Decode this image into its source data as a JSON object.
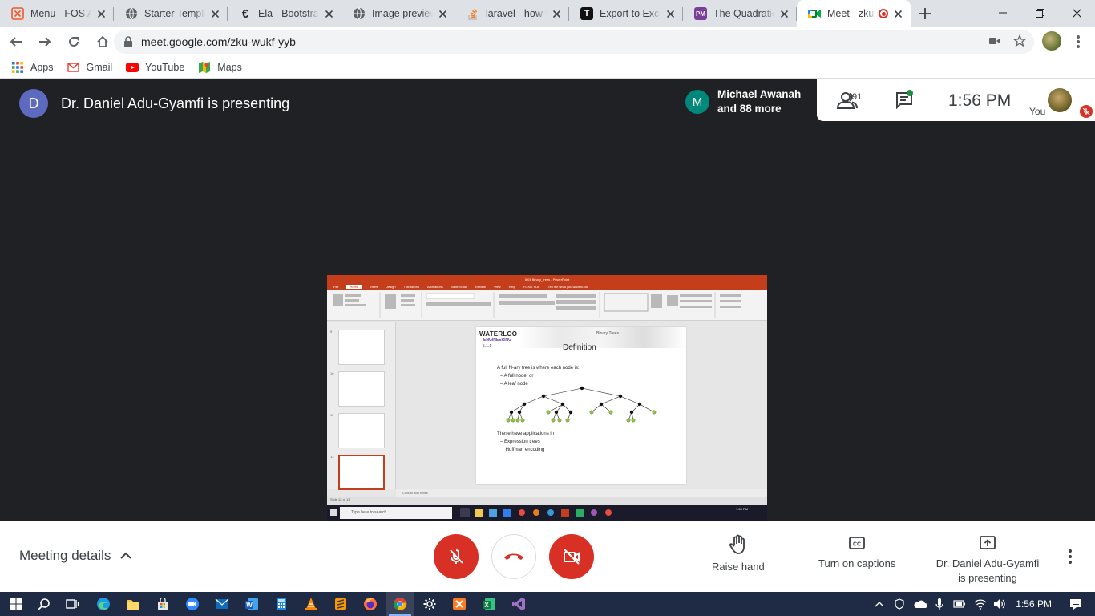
{
  "browser": {
    "tabs": [
      {
        "title": "Menu - FOS Ad",
        "icon": "xampp-icon",
        "color": "#f1592a",
        "glyph": "⊠"
      },
      {
        "title": "Starter Templa",
        "icon": "globe-icon",
        "color": "#5f6368",
        "glyph": ""
      },
      {
        "title": "Ela - Bootstrap",
        "icon": "ela-icon",
        "color": "#202124",
        "glyph": "€"
      },
      {
        "title": "Image preview",
        "icon": "globe-icon",
        "color": "#5f6368",
        "glyph": ""
      },
      {
        "title": "laravel - how to",
        "icon": "stackoverflow-icon",
        "color": "#f48024",
        "glyph": ""
      },
      {
        "title": "Export to Excel",
        "icon": "t-icon",
        "color": "#111111",
        "glyph": "T"
      },
      {
        "title": "The Quadratic",
        "icon": "pm-icon",
        "color": "#7b3f99",
        "glyph": "PM"
      },
      {
        "title": "Meet - zku",
        "icon": "meet-icon",
        "color": "#00832d",
        "glyph": ""
      }
    ],
    "url": "meet.google.com/zku-wukf-yyb",
    "bookmarks": [
      {
        "label": "Apps",
        "icon": "apps-grid-icon"
      },
      {
        "label": "Gmail",
        "icon": "gmail-icon"
      },
      {
        "label": "YouTube",
        "icon": "youtube-icon"
      },
      {
        "label": "Maps",
        "icon": "maps-icon"
      }
    ]
  },
  "meet": {
    "presenter_initial": "D",
    "presenter_text": "Dr. Daniel Adu-Gyamfi is presenting",
    "participant_initial": "M",
    "participant_line1": "Michael Awanah",
    "participant_line2": "and 88 more",
    "people_count": "91",
    "time": "1:56  PM",
    "you_label": "You",
    "colors": {
      "accent_red": "#d93025",
      "presenter_avatar": "#5c6bc0",
      "participant_avatar": "#00897b"
    }
  },
  "shared_screen": {
    "window_title": "5.01 Binary_trees - PowerPoint",
    "ribbon_tabs": [
      "File",
      "Home",
      "Insert",
      "Design",
      "Transitions",
      "Animations",
      "Slide Show",
      "Review",
      "View",
      "Help",
      "FOXIT PDF",
      "Tell me what you want to do"
    ],
    "thumb_numbers": [
      "9",
      "10",
      "11",
      "12"
    ],
    "slide": {
      "logo": "WATERLOO",
      "logo_sub": "ENGINEERING",
      "number": "5.1.1",
      "header": "Binary Trees",
      "title": "Definition",
      "lines": [
        "A full N-ary tree is where each node is:",
        "–  A full node, or",
        "–  A leaf node",
        "These have applications in",
        "–  Expression trees",
        "    Huffman encoding"
      ]
    },
    "notes_placeholder": "Click to add notes",
    "status": "Slide 12 of 13",
    "taskbar_search": "Type here to search",
    "taskbar_time": "1:55 PM"
  },
  "controls": {
    "meeting_details": "Meeting details",
    "raise_hand": "Raise hand",
    "captions": "Turn on captions",
    "presenting_line1": "Dr. Daniel Adu-Gyamfi",
    "presenting_line2": "is presenting"
  },
  "taskbar": {
    "time": "1:56 PM"
  }
}
